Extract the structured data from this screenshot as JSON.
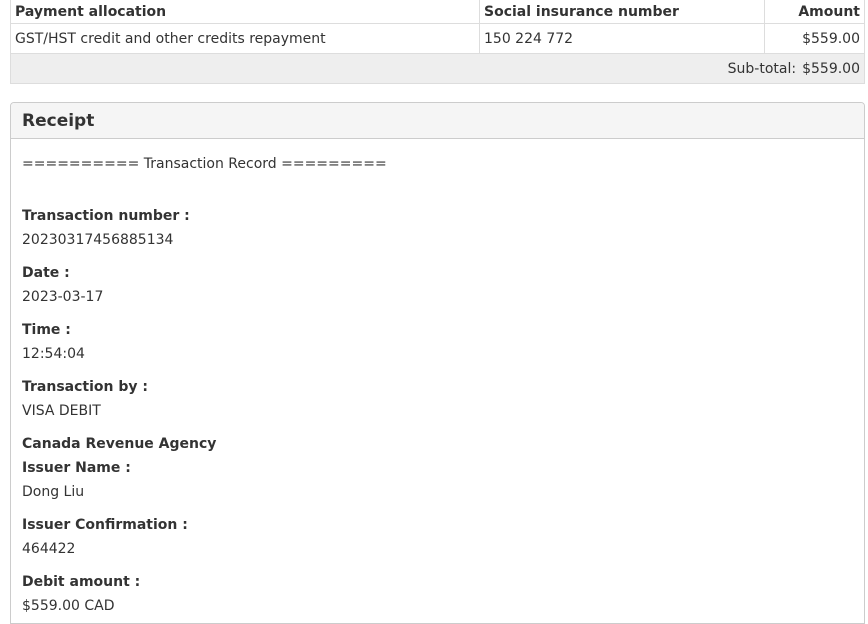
{
  "allocation_table": {
    "headers": {
      "payment_allocation": "Payment allocation",
      "sin": "Social insurance number",
      "amount": "Amount"
    },
    "rows": [
      {
        "allocation": "GST/HST credit and other credits repayment",
        "sin": "150 224 772",
        "amount": "$559.00"
      }
    ],
    "subtotal_label": "Sub-total:",
    "subtotal_value": "$559.00"
  },
  "receipt": {
    "heading": "Receipt",
    "record_title": "========== Transaction Record =========",
    "transaction_number_label": "Transaction number :",
    "transaction_number": "20230317456885134",
    "date_label": "Date :",
    "date": "2023-03-17",
    "time_label": "Time :",
    "time": "12:54:04",
    "transaction_by_label": "Transaction by :",
    "transaction_by": "VISA DEBIT",
    "agency": "Canada Revenue Agency",
    "issuer_name_label": "Issuer Name :",
    "issuer_name": "Dong Liu",
    "issuer_confirmation_label": "Issuer Confirmation :",
    "issuer_confirmation": "464422",
    "debit_amount_label": "Debit amount :",
    "debit_amount": "$559.00 CAD"
  }
}
